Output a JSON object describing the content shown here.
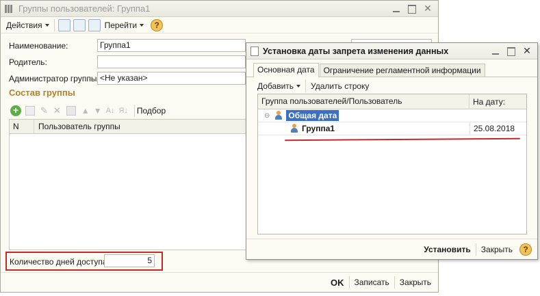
{
  "main_window": {
    "title": "Группы пользователей: Группа1",
    "toolbar": {
      "actions_label": "Действия",
      "goto_label": "Перейти"
    },
    "fields": {
      "name_label": "Наименование:",
      "name_value": "Группа1",
      "parent_label": "Родитель:",
      "parent_value": "",
      "admin_label": "Администратор группы:",
      "admin_value": "<Не указан>"
    },
    "composition": {
      "title": "Состав группы",
      "pick_label": "Подбор",
      "columns": [
        "N",
        "Пользователь группы"
      ]
    },
    "access_days": {
      "label": "Количество дней доступа:",
      "value": "5"
    },
    "buttons": {
      "ok": "OK",
      "save": "Записать",
      "close": "Закрыть"
    }
  },
  "dialog": {
    "title": "Установка даты запрета изменения данных",
    "tabs": [
      "Основная дата",
      "Ограничение регламентной информации"
    ],
    "toolbar": {
      "add_label": "Добавить",
      "delete_label": "Удалить строку"
    },
    "table": {
      "columns": [
        "Группа пользователей/Пользователь",
        "На дату:"
      ],
      "rows": [
        {
          "name": "Общая дата",
          "date": ""
        },
        {
          "name": "Группа1",
          "date": "25.08.2018"
        }
      ]
    },
    "buttons": {
      "set": "Установить",
      "close": "Закрыть"
    }
  },
  "colors": {
    "highlight_red": "#c62828",
    "selection_blue": "#3b6fc1",
    "section_title": "#b0822a"
  }
}
